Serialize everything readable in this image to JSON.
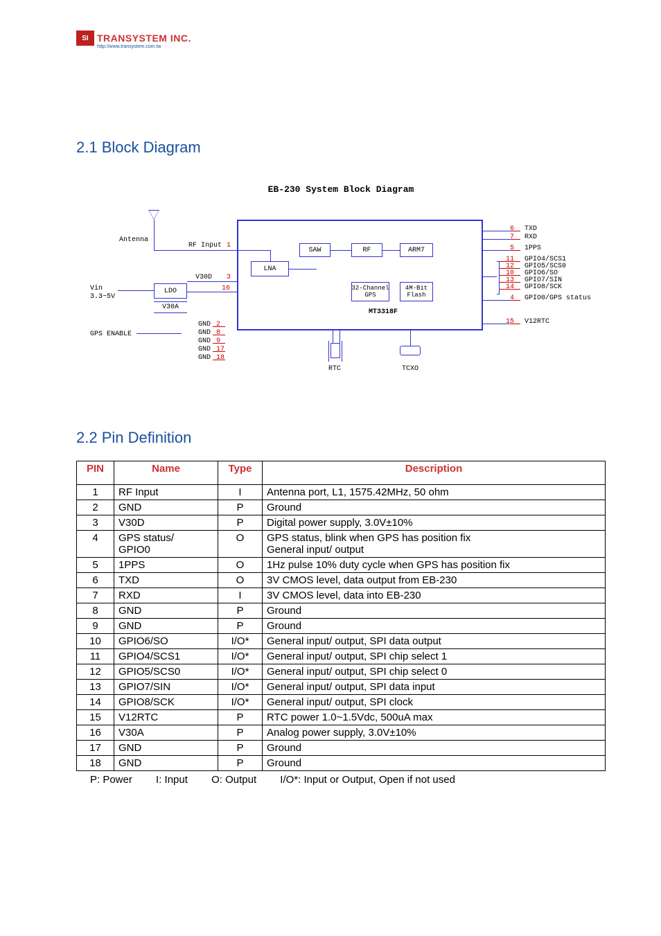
{
  "logo": {
    "icon_text": "SI",
    "brand": "TRANSYSTEM INC.",
    "url": "http://www.transystem.com.tw"
  },
  "section1_title": "2.1  Block Diagram",
  "section2_title": "2.2  Pin Definition",
  "diagram": {
    "title": "EB-230 System Block Diagram",
    "labels": {
      "antenna": "Antenna",
      "rf_input": "RF Input",
      "pin1": "1",
      "vin": "Vin",
      "vin_range": "3.3~5V",
      "ldo": "LDO",
      "v30d": "V30D",
      "pin3": "3",
      "pin16": "16",
      "v30a": "V30A",
      "gps_enable": "GPS ENABLE",
      "gnd": "GND",
      "gnd_pins": [
        "2",
        "8",
        "9",
        "17",
        "18"
      ],
      "lna": "LNA",
      "saw": "SAW",
      "rf": "RF",
      "arm7": "ARM7",
      "gps32": "32-Channel\nGPS",
      "flash": "4M-Bit\nFlash",
      "chip": "MT3318F",
      "rtc": "RTC",
      "tcxo": "TCXO",
      "out": [
        {
          "pin": "6",
          "name": "TXD"
        },
        {
          "pin": "7",
          "name": "RXD"
        },
        {
          "pin": "5",
          "name": "1PPS"
        },
        {
          "pin": "11",
          "name": "GPIO4/SCS1"
        },
        {
          "pin": "12",
          "name": "GPIO5/SCS0"
        },
        {
          "pin": "10",
          "name": "GPIO6/SO"
        },
        {
          "pin": "13",
          "name": "GPIO7/SIN"
        },
        {
          "pin": "14",
          "name": "GPIO8/SCK"
        },
        {
          "pin": "4",
          "name": "GPIO0/GPS status"
        },
        {
          "pin": "15",
          "name": "V12RTC"
        }
      ]
    }
  },
  "table": {
    "headers": [
      "PIN",
      "Name",
      "Type",
      "Description"
    ],
    "rows": [
      {
        "pin": "1",
        "name": "RF Input",
        "type": "I",
        "desc": "Antenna port, L1, 1575.42MHz, 50 ohm"
      },
      {
        "pin": "2",
        "name": "GND",
        "type": "P",
        "desc": "Ground"
      },
      {
        "pin": "3",
        "name": "V30D",
        "type": "P",
        "desc": "Digital power supply, 3.0V±10%"
      },
      {
        "pin": "4",
        "name": "GPS status/\nGPIO0",
        "type": "O",
        "desc": "GPS status, blink when GPS has position fix\nGeneral input/ output"
      },
      {
        "pin": "5",
        "name": "1PPS",
        "type": "O",
        "desc": "1Hz pulse 10% duty cycle when GPS has position fix"
      },
      {
        "pin": "6",
        "name": "TXD",
        "type": "O",
        "desc": "3V CMOS level, data output from EB-230"
      },
      {
        "pin": "7",
        "name": "RXD",
        "type": "I",
        "desc": "3V CMOS level, data into EB-230"
      },
      {
        "pin": "8",
        "name": "GND",
        "type": "P",
        "desc": "Ground"
      },
      {
        "pin": "9",
        "name": "GND",
        "type": "P",
        "desc": "Ground"
      },
      {
        "pin": "10",
        "name": "GPIO6/SO",
        "type": "I/O*",
        "desc": "General input/ output, SPI data output"
      },
      {
        "pin": "11",
        "name": "GPIO4/SCS1",
        "type": "I/O*",
        "desc": "General input/ output, SPI chip select 1"
      },
      {
        "pin": "12",
        "name": "GPIO5/SCS0",
        "type": "I/O*",
        "desc": "General input/ output, SPI chip select 0"
      },
      {
        "pin": "13",
        "name": "GPIO7/SIN",
        "type": "I/O*",
        "desc": "General input/ output, SPI data input"
      },
      {
        "pin": "14",
        "name": "GPIO8/SCK",
        "type": "I/O*",
        "desc": "General input/ output, SPI clock"
      },
      {
        "pin": "15",
        "name": "V12RTC",
        "type": "P",
        "desc": "RTC power 1.0~1.5Vdc, 500uA max"
      },
      {
        "pin": "16",
        "name": "V30A",
        "type": "P",
        "desc": "Analog power supply, 3.0V±10%"
      },
      {
        "pin": "17",
        "name": "GND",
        "type": "P",
        "desc": "Ground"
      },
      {
        "pin": "18",
        "name": "GND",
        "type": "P",
        "desc": "Ground"
      }
    ]
  },
  "legend": {
    "p": "P: Power",
    "i": "I: Input",
    "o": "O: Output",
    "io": "I/O*: Input or Output, Open if not used"
  }
}
